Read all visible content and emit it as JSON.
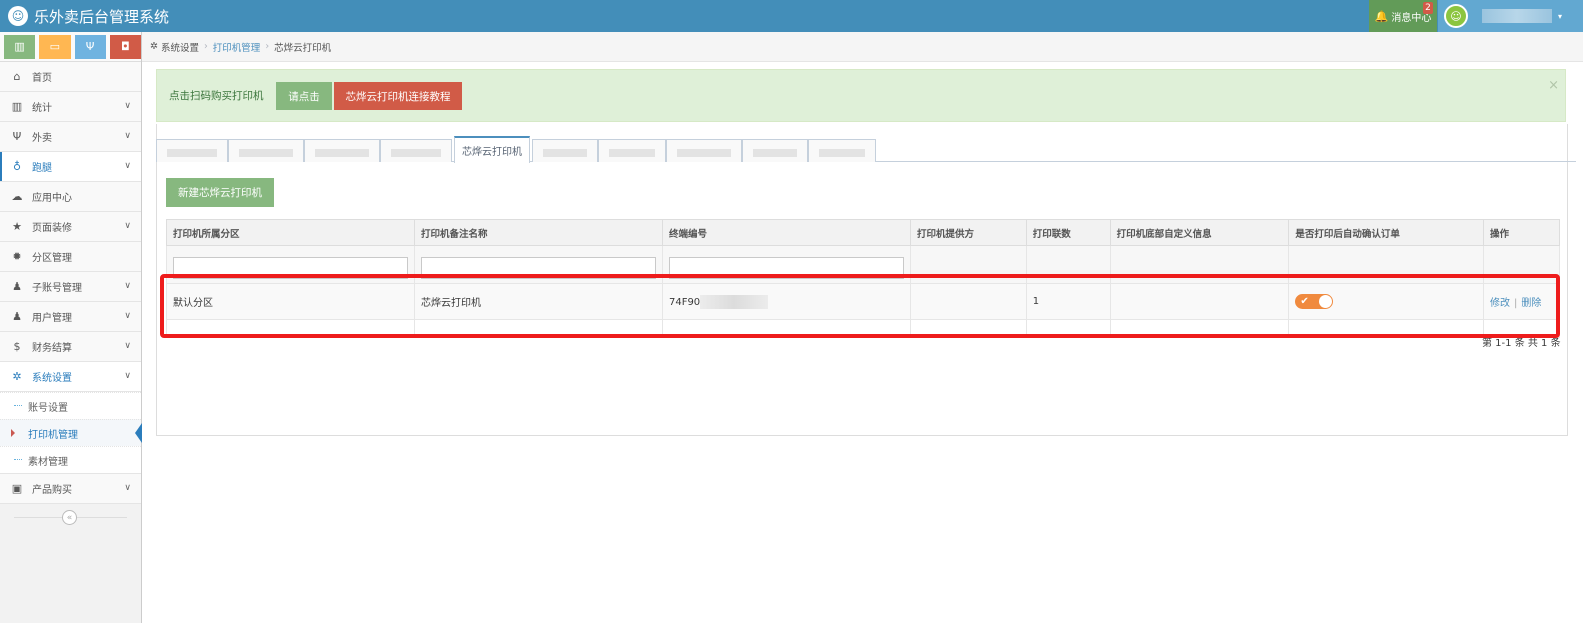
{
  "app": {
    "title": "乐外卖后台管理系统",
    "logo_icon": "smile-logo-icon"
  },
  "topbar": {
    "message_center_label": "消息中心",
    "message_count": "2",
    "user_caret": "▾"
  },
  "shortcuts": [
    {
      "name": "chart",
      "icon": "bar-chart-icon"
    },
    {
      "name": "desktop",
      "icon": "desktop-icon"
    },
    {
      "name": "food",
      "icon": "cutlery-icon"
    },
    {
      "name": "bag",
      "icon": "shopping-bag-icon"
    }
  ],
  "sidebar": {
    "items": [
      {
        "label": "首页",
        "icon": "home-icon"
      },
      {
        "label": "统计",
        "icon": "bar-chart-icon"
      },
      {
        "label": "外卖",
        "icon": "cutlery-icon"
      },
      {
        "label": "跑腿",
        "icon": "bicycle-icon"
      },
      {
        "label": "应用中心",
        "icon": "cloud-icon"
      },
      {
        "label": "页面装修",
        "icon": "star-icon"
      },
      {
        "label": "分区管理",
        "icon": "gear-icon"
      },
      {
        "label": "子账号管理",
        "icon": "user-icon"
      },
      {
        "label": "用户管理",
        "icon": "users-icon"
      },
      {
        "label": "财务结算",
        "icon": "dollar-icon"
      },
      {
        "label": "系统设置",
        "icon": "cog-icon"
      },
      {
        "label": "产品购买",
        "icon": "briefcase-icon"
      }
    ],
    "submenu": [
      {
        "label": "账号设置"
      },
      {
        "label": "打印机管理"
      },
      {
        "label": "素材管理"
      }
    ],
    "collapse_icon": "«"
  },
  "breadcrumb": {
    "home": "系统设置",
    "link": "打印机管理",
    "current": "芯烨云打印机"
  },
  "alert": {
    "text": "点击扫码购买打印机",
    "btn_click": "请点击",
    "btn_tutorial": "芯烨云打印机连接教程",
    "close": "×"
  },
  "tabs": {
    "active": "芯烨云打印机"
  },
  "actions": {
    "new_printer": "新建芯烨云打印机"
  },
  "table": {
    "headers": [
      "打印机所属分区",
      "打印机备注名称",
      "终端编号",
      "打印机提供方",
      "打印联数",
      "打印机底部自定义信息",
      "是否打印后自动确认订单",
      "操作"
    ],
    "rows": [
      {
        "zone": "默认分区",
        "name": "芯烨云打印机",
        "code": "74F90",
        "provider": "",
        "copies": "1",
        "footer": "",
        "auto_confirm": true,
        "edit": "修改",
        "delete": "删除"
      }
    ]
  },
  "pager": {
    "text": "第 1-1 条 共 1 条"
  },
  "colors": {
    "navbar": "#438eb9",
    "accent_green": "#87b87f",
    "accent_red": "#d15b47",
    "highlight_red": "#ee1c1c",
    "toggle_orange": "#f08a3e"
  }
}
